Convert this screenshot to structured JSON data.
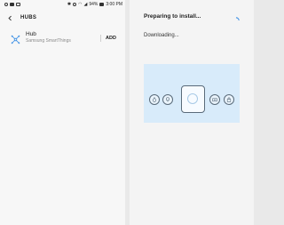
{
  "status_bar": {
    "battery": "94%",
    "time": "3:00 PM"
  },
  "app_bar": {
    "title": "HUBS",
    "back_icon": "back-arrow-icon"
  },
  "hub": {
    "name": "Hub",
    "subtitle": "Samsung SmartThings",
    "add_label": "ADD",
    "icon": "hub-network-icon"
  },
  "install": {
    "title": "Preparing to install...",
    "status": "Downloading..."
  },
  "colors": {
    "illustration_bg": "#d8ebfa",
    "spinner": "#3e91e6",
    "hub_icon": "#3e91e6"
  }
}
